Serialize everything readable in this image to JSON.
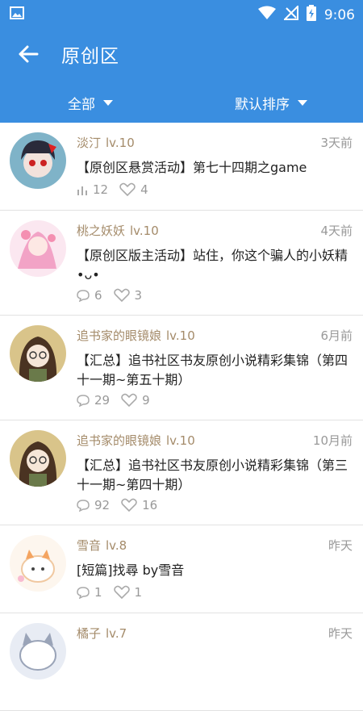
{
  "statusbar": {
    "time": "9:06"
  },
  "appbar": {
    "title": "原创区"
  },
  "filters": {
    "left": "全部",
    "right": "默认排序"
  },
  "posts": [
    {
      "author": "淡汀",
      "level": "lv.10",
      "time": "3天前",
      "content": "【原创区悬赏活动】第七十四期之game",
      "stat_icon": "bar-chart-icon",
      "stat_value": "12",
      "likes": "4"
    },
    {
      "author": "桃之妖妖",
      "level": "lv.10",
      "time": "4天前",
      "content": "【原创区版主活动】站住，你这个骗人的小妖精•ᴗ•",
      "stat_icon": "comment-icon",
      "stat_value": "6",
      "likes": "3"
    },
    {
      "author": "追书家的眼镜娘",
      "level": "lv.10",
      "time": "6月前",
      "content": "【汇总】追书社区书友原创小说精彩集锦（第四十一期~第五十期）",
      "stat_icon": "comment-icon",
      "stat_value": "29",
      "likes": "9"
    },
    {
      "author": "追书家的眼镜娘",
      "level": "lv.10",
      "time": "10月前",
      "content": "【汇总】追书社区书友原创小说精彩集锦（第三十一期~第四十期）",
      "stat_icon": "comment-icon",
      "stat_value": "92",
      "likes": "16"
    },
    {
      "author": "雪音",
      "level": "lv.8",
      "time": "昨天",
      "content": "[短篇]找尋 by雪音",
      "stat_icon": "comment-icon",
      "stat_value": "1",
      "likes": "1"
    },
    {
      "author": "橘子",
      "level": "lv.7",
      "time": "昨天",
      "content": "",
      "stat_icon": "comment-icon",
      "stat_value": "",
      "likes": ""
    }
  ],
  "colors": {
    "primary": "#3a8ee0",
    "author": "#a48b6a",
    "meta": "#999999"
  }
}
